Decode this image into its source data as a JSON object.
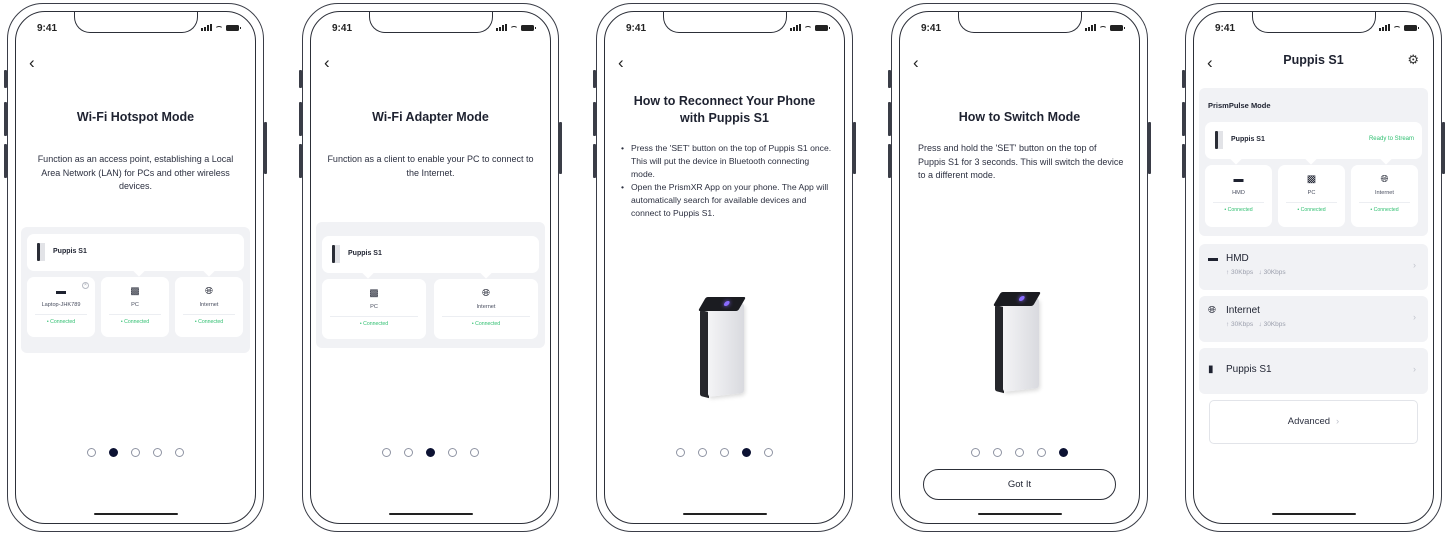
{
  "status": {
    "time": "9:41"
  },
  "screen1": {
    "title": "Wi-Fi Hotspot Mode",
    "description": "Function as an access point, establishing a Local Area Network (LAN) for PCs and other wireless devices.",
    "device_name": "Puppis S1",
    "nodes": [
      {
        "label": "Laptop-JHK789",
        "status": "Connected",
        "icon": "headset-icon"
      },
      {
        "label": "PC",
        "status": "Connected",
        "icon": "pc-icon"
      },
      {
        "label": "Internet",
        "status": "Connected",
        "icon": "globe-icon"
      }
    ],
    "active_page": 2,
    "page_count": 5
  },
  "screen2": {
    "title": "Wi-Fi Adapter Mode",
    "description": "Function as a client to enable your PC to connect to the Internet.",
    "device_name": "Puppis S1",
    "nodes": [
      {
        "label": "PC",
        "status": "Connected",
        "icon": "pc-icon"
      },
      {
        "label": "Internet",
        "status": "Connected",
        "icon": "globe-icon"
      }
    ],
    "active_page": 3,
    "page_count": 5
  },
  "screen3": {
    "title": "How to Reconnect Your Phone with Puppis S1",
    "bullets": [
      "Press the 'SET' button on the top of Puppis S1 once. This will put the device in Bluetooth connecting mode.",
      "Open the PrismXR App on your phone. The App will automatically search for available devices and connect to Puppis S1."
    ],
    "active_page": 4,
    "page_count": 5
  },
  "screen4": {
    "title": "How to Switch Mode",
    "description": "Press and hold the 'SET' button on the top of Puppis S1 for 3 seconds. This will switch the device to a different mode.",
    "button": "Got It",
    "active_page": 5,
    "page_count": 5
  },
  "screen5": {
    "header_title": "Puppis S1",
    "mode_label": "PrismPulse Mode",
    "device_name": "Puppis S1",
    "device_status": "Ready to Stream",
    "nodes": [
      {
        "label": "HMD",
        "status": "Connected",
        "icon": "headset-icon"
      },
      {
        "label": "PC",
        "status": "Connected",
        "icon": "pc-icon"
      },
      {
        "label": "Internet",
        "status": "Connected",
        "icon": "globe-icon"
      }
    ],
    "list": [
      {
        "title": "HMD",
        "up": "↑ 30Kbps",
        "down": "↓ 30Kbps",
        "icon": "headset-icon"
      },
      {
        "title": "Internet",
        "up": "↑ 30Kbps",
        "down": "↓ 30Kbps",
        "icon": "globe-icon"
      },
      {
        "title": "Puppis S1",
        "icon": "router-icon"
      }
    ],
    "advanced": "Advanced"
  },
  "colors": {
    "accent": "#0c1233",
    "connected": "#2fbf70",
    "panel": "#f1f2f5"
  }
}
